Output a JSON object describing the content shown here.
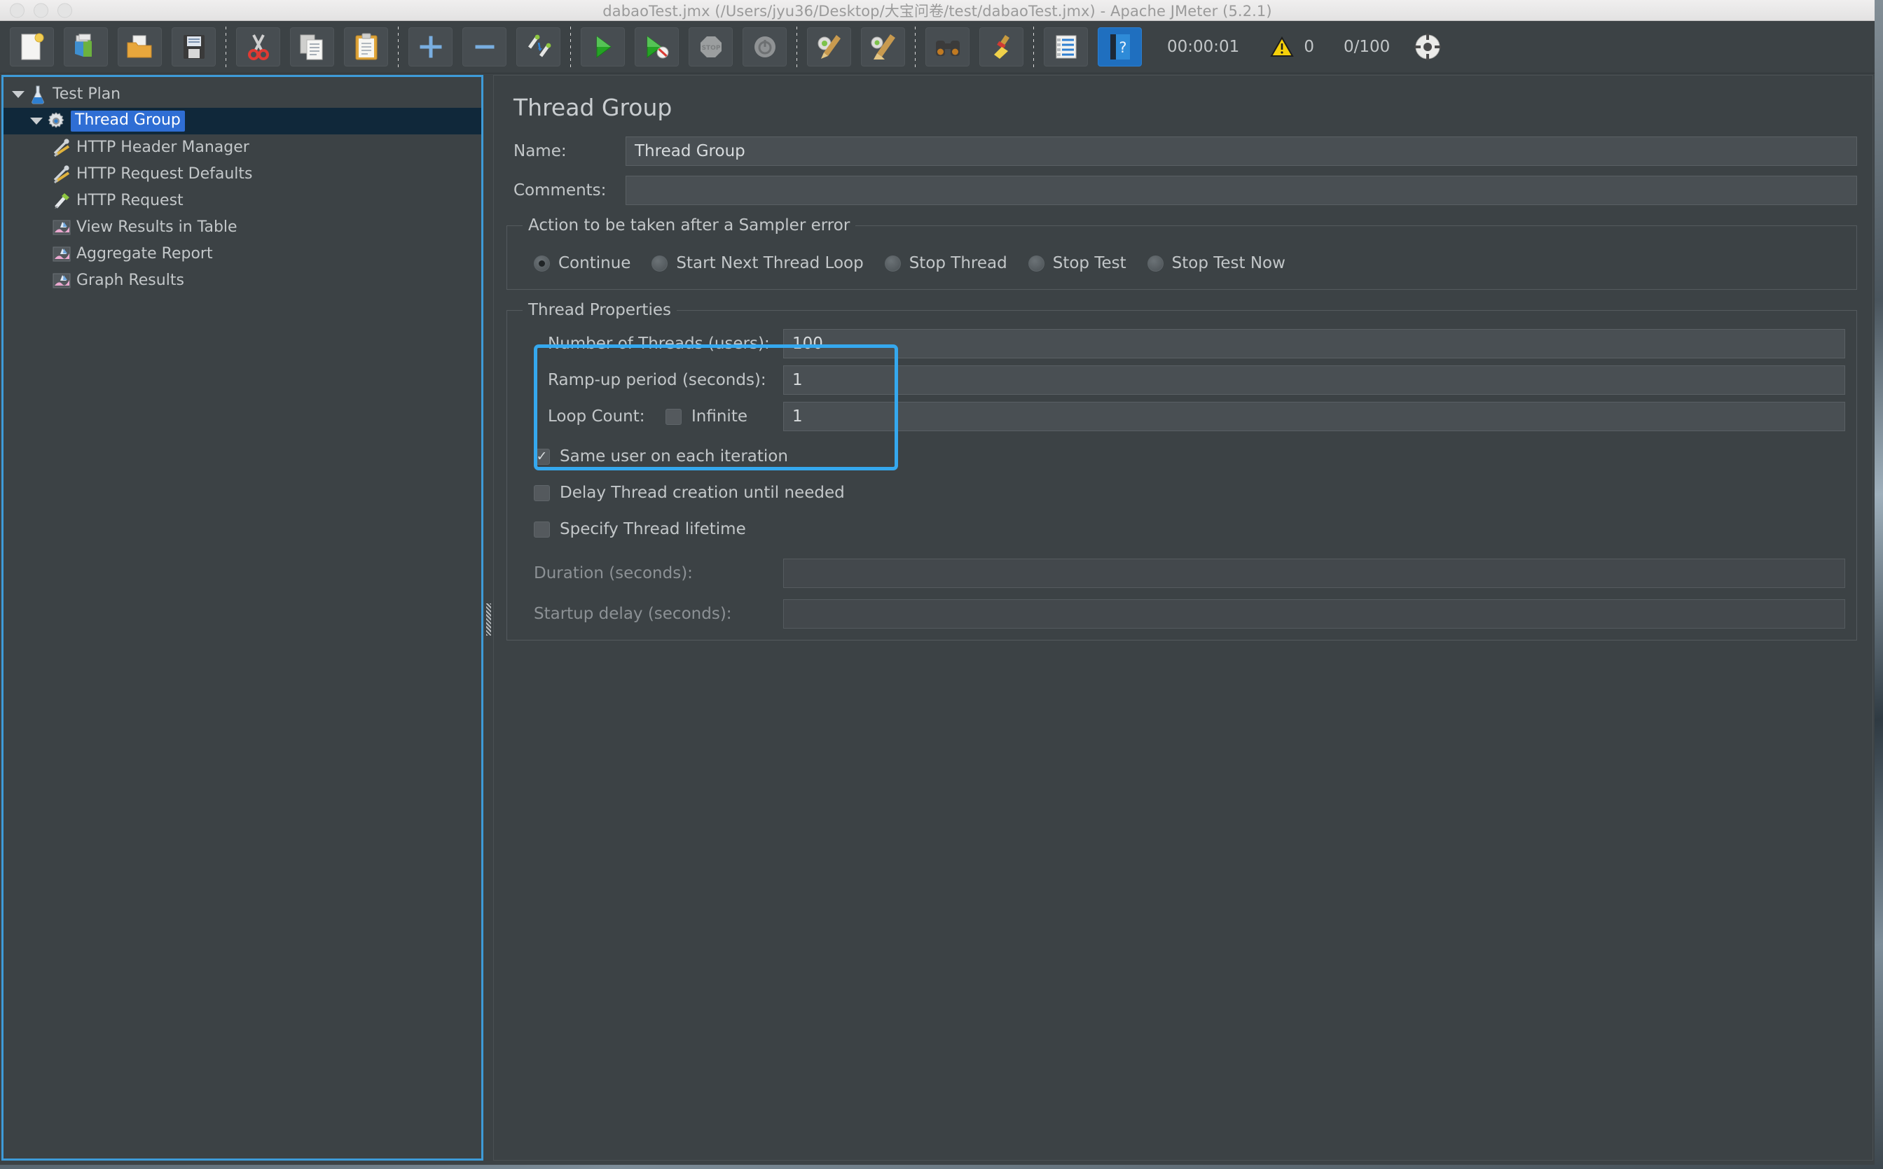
{
  "window": {
    "title": "dabaoTest.jmx (/Users/jyu36/Desktop/大宝问卷/test/dabaoTest.jmx) - Apache JMeter (5.2.1)"
  },
  "toolbar": {
    "groups": [
      [
        {
          "name": "new-test-plan-button",
          "icon": "new-document-icon"
        },
        {
          "name": "templates-button",
          "icon": "templates-books-icon"
        },
        {
          "name": "open-button",
          "icon": "open-folder-icon"
        },
        {
          "name": "save-button",
          "icon": "save-floppy-icon"
        }
      ],
      [
        {
          "name": "cut-button",
          "icon": "scissors-icon"
        },
        {
          "name": "copy-button",
          "icon": "copy-pages-icon"
        },
        {
          "name": "paste-button",
          "icon": "paste-clipboard-icon"
        }
      ],
      [
        {
          "name": "expand-all-button",
          "icon": "plus-icon"
        },
        {
          "name": "collapse-all-button",
          "icon": "minus-icon"
        },
        {
          "name": "toggle-button",
          "icon": "toggle-pencils-icon"
        }
      ],
      [
        {
          "name": "start-button",
          "icon": "play-green-icon"
        },
        {
          "name": "start-no-pauses-button",
          "icon": "play-no-pauses-icon"
        },
        {
          "name": "stop-button",
          "icon": "stop-octagon-icon"
        },
        {
          "name": "shutdown-button",
          "icon": "shutdown-circle-icon"
        }
      ],
      [
        {
          "name": "clear-button",
          "icon": "gear-broom-icon"
        },
        {
          "name": "clear-all-button",
          "icon": "broom-icon"
        }
      ],
      [
        {
          "name": "search-button",
          "icon": "binoculars-icon"
        },
        {
          "name": "reset-search-button",
          "icon": "yellow-broom-icon"
        }
      ],
      [
        {
          "name": "function-helper-button",
          "icon": "list-lines-icon"
        },
        {
          "name": "help-button",
          "icon": "help-book-icon"
        }
      ]
    ],
    "status": {
      "timer": "00:00:01",
      "warning_icon": "warning-triangle-icon",
      "warning_count": "0",
      "threads": "0/100",
      "gauge_icon": "thread-gauge-icon"
    }
  },
  "tree": {
    "items": [
      {
        "label": "Test Plan",
        "icon": "flask-icon",
        "level": 1,
        "expanded": true,
        "selected": false
      },
      {
        "label": "Thread Group",
        "icon": "gear-icon",
        "level": 2,
        "expanded": true,
        "selected": true
      },
      {
        "label": "HTTP Header Manager",
        "icon": "wrench-icon",
        "level": 3,
        "expanded": null,
        "selected": false
      },
      {
        "label": "HTTP Request Defaults",
        "icon": "wrench-icon",
        "level": 3,
        "expanded": null,
        "selected": false
      },
      {
        "label": "HTTP Request",
        "icon": "pencil-icon",
        "level": 3,
        "expanded": null,
        "selected": false
      },
      {
        "label": "View Results in Table",
        "icon": "chart-icon",
        "level": 3,
        "expanded": null,
        "selected": false
      },
      {
        "label": "Aggregate Report",
        "icon": "chart-icon",
        "level": 3,
        "expanded": null,
        "selected": false
      },
      {
        "label": "Graph Results",
        "icon": "chart-icon",
        "level": 3,
        "expanded": null,
        "selected": false
      }
    ]
  },
  "main": {
    "heading": "Thread Group",
    "name_label": "Name:",
    "name_value": "Thread Group",
    "comments_label": "Comments:",
    "comments_value": "",
    "sampler_error": {
      "legend": "Action to be taken after a Sampler error",
      "options": [
        {
          "label": "Continue",
          "selected": true
        },
        {
          "label": "Start Next Thread Loop",
          "selected": false
        },
        {
          "label": "Stop Thread",
          "selected": false
        },
        {
          "label": "Stop Test",
          "selected": false
        },
        {
          "label": "Stop Test Now",
          "selected": false
        }
      ]
    },
    "thread_properties": {
      "legend": "Thread Properties",
      "num_threads_label": "Number of Threads (users):",
      "num_threads_value": "100",
      "rampup_label": "Ramp-up period (seconds):",
      "rampup_value": "1",
      "loop_count_label": "Loop Count:",
      "infinite_label": "Infinite",
      "infinite_checked": false,
      "loop_count_value": "1",
      "checkboxes": [
        {
          "label": "Same user on each iteration",
          "checked": true
        },
        {
          "label": "Delay Thread creation until needed",
          "checked": false
        },
        {
          "label": "Specify Thread lifetime",
          "checked": false
        }
      ],
      "duration_label": "Duration (seconds):",
      "duration_value": "",
      "startup_delay_label": "Startup delay (seconds):",
      "startup_delay_value": ""
    }
  },
  "colors": {
    "accent_highlight": "#35a8ee",
    "focus_border": "#3e9bd8",
    "selection_blue": "#2f6ed4",
    "panel_bg": "#3c4245",
    "text": "#c3c7c9"
  }
}
